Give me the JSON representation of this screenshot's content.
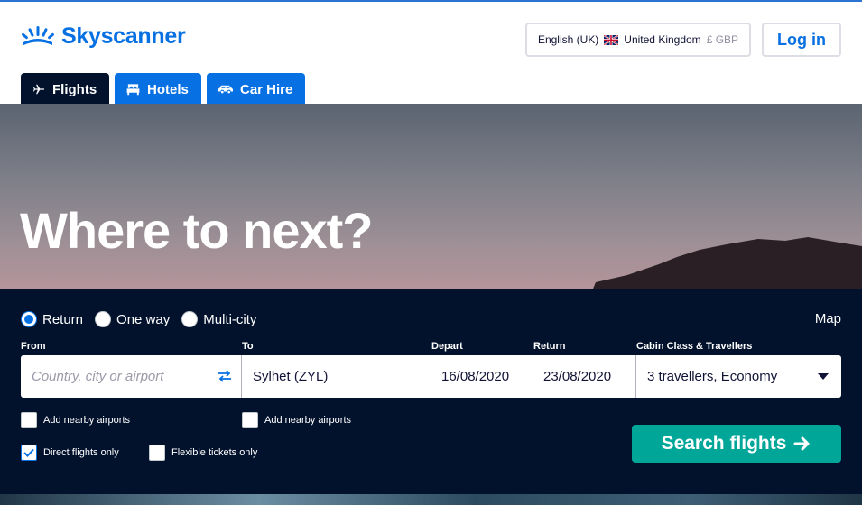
{
  "brand": {
    "name": "Skyscanner",
    "color": "#0770e3"
  },
  "locale": {
    "language": "English (UK)",
    "country": "United Kingdom",
    "currency": "£ GBP"
  },
  "auth": {
    "login_label": "Log in"
  },
  "tabs": [
    {
      "label": "Flights",
      "icon": "plane-icon",
      "active": true
    },
    {
      "label": "Hotels",
      "icon": "bed-icon",
      "active": false
    },
    {
      "label": "Car Hire",
      "icon": "car-icon",
      "active": false
    }
  ],
  "hero": {
    "title": "Where to next?"
  },
  "search": {
    "trip_types": [
      {
        "label": "Return",
        "checked": true
      },
      {
        "label": "One way",
        "checked": false
      },
      {
        "label": "Multi-city",
        "checked": false
      }
    ],
    "map_label": "Map",
    "labels": {
      "from": "From",
      "to": "To",
      "depart": "Depart",
      "return": "Return",
      "cabin": "Cabin Class & Travellers"
    },
    "from": {
      "placeholder": "Country, city or airport",
      "value": ""
    },
    "to": {
      "value": "Sylhet (ZYL)"
    },
    "depart": {
      "value": "16/08/2020"
    },
    "return": {
      "value": "23/08/2020"
    },
    "cabin": {
      "value": "3 travellers, Economy"
    },
    "options": {
      "nearby_from": {
        "label": "Add nearby airports",
        "checked": false
      },
      "nearby_to": {
        "label": "Add nearby airports",
        "checked": false
      },
      "direct": {
        "label": "Direct flights only",
        "checked": true
      },
      "flexible": {
        "label": "Flexible tickets only",
        "checked": false
      }
    },
    "submit_label": "Search flights",
    "submit_color": "#00a698"
  },
  "colors": {
    "panel": "#02122c",
    "tab_active": "#02122c",
    "tab_inactive": "#0770e3"
  }
}
